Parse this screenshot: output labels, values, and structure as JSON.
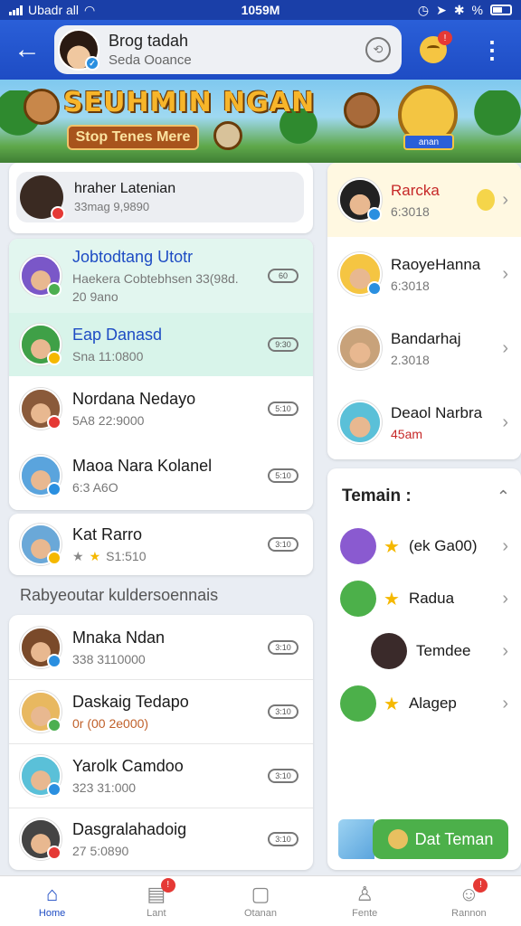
{
  "status_bar": {
    "carrier": "Ubadr all",
    "time": "1059M",
    "battery": "%"
  },
  "header": {
    "back_icon": "arrow-left-icon",
    "search": {
      "name": "Brog tadah",
      "subtitle": "Seda Ooance"
    },
    "notification_count": "!"
  },
  "banner": {
    "title": "SEUHMIN NGAN",
    "button": "Stop Tenes Mere",
    "tag": "anan"
  },
  "left_top": {
    "name": "hraher Latenian",
    "sub": "33mag 9,9890"
  },
  "chats": [
    {
      "name": "Jobtodtang Utotr",
      "sub": "Haekera Cobtebhsen 33(98d.",
      "sub2": "20 9ano",
      "pill": "60",
      "highlight": "#e2f6ef",
      "avatar": "#7a57c8",
      "dot": "#4caf50",
      "name_color": "#1e4cc4"
    },
    {
      "name": "Eap Danasd",
      "sub": "Sna  11:0800",
      "pill": "9:30",
      "highlight": "#d8f4ea",
      "avatar": "#3fa047",
      "dot": "#f5b800",
      "name_color": "#1e4cc4"
    },
    {
      "name": "Nordana Nedayo",
      "sub": "5A8  22:9000",
      "pill": "5:10",
      "highlight": "#ffffff",
      "avatar": "#8a5a3a",
      "dot": "#e53935",
      "name_color": "#1a1a1a"
    },
    {
      "name": "Maoa Nara Kolanel",
      "sub": "6:3  A6O",
      "pill": "5:10",
      "highlight": "#ffffff",
      "avatar": "#5aa4dd",
      "dot": "#2a8fe0",
      "name_color": "#1a1a1a"
    },
    {
      "name": "Kat Rarro",
      "sub": "S1:510",
      "pill": "3:10",
      "highlight": "#ffffff",
      "avatar": "#6aa8d8",
      "dot": "#f5b800",
      "name_color": "#1a1a1a"
    }
  ],
  "section_label": "Rabyeoutar kuldersoennais",
  "chats2": [
    {
      "name": "Mnaka Ndan",
      "sub": "338  3110000",
      "pill": "3:10",
      "avatar": "#7a4a2a",
      "dot": "#2a8fe0"
    },
    {
      "name": "Daskaig Tedapo",
      "sub": "0r  (00 2e000)",
      "pill": "3:10",
      "avatar": "#e8b860",
      "dot": "#4caf50"
    },
    {
      "name": "Yarolk Camdoo",
      "sub": "323  31:000",
      "pill": "3:10",
      "avatar": "#5ac0d8",
      "dot": "#2a8fe0"
    },
    {
      "name": "Dasgralahadoig",
      "sub": "27  5:0890",
      "pill": "3:10",
      "avatar": "#444444",
      "dot": "#e53935"
    }
  ],
  "right_top": [
    {
      "name": "Rarcka",
      "sub": "6:3018",
      "avatar": "#222222",
      "name_color": "#c62828",
      "bg": "#fff8e1",
      "dot": "#2a8fe0"
    },
    {
      "name": "RaoyeHanna",
      "sub": "6:3018",
      "avatar": "#f5c542",
      "name_color": "#1a1a1a",
      "bg": "#ffffff",
      "dot": "#2a8fe0"
    },
    {
      "name": "Bandarhaj",
      "sub": "2.3018",
      "avatar": "#c8a27a",
      "name_color": "#1a1a1a",
      "bg": "#ffffff",
      "dot": ""
    },
    {
      "name": "Deaol Narbra",
      "sub": "45am",
      "avatar": "#5ac0d8",
      "name_color": "#1a1a1a",
      "bg": "#ffffff",
      "dot": ""
    }
  ],
  "teman": {
    "title": "Temain :",
    "items": [
      {
        "name": "(ek Ga00)",
        "avatar": "#8a5ad0"
      },
      {
        "name": "Radua",
        "avatar": "#4cb04a"
      },
      {
        "name": "Temdee",
        "avatar": "#3a2a2a"
      },
      {
        "name": "Alagep",
        "avatar": "#4cb04a"
      }
    ]
  },
  "add_button": "Dat Teman",
  "nav": [
    {
      "label": "Home",
      "icon": "home-icon",
      "badge": ""
    },
    {
      "label": "Lant",
      "icon": "chat-icon",
      "badge": "!"
    },
    {
      "label": "Otanan",
      "icon": "square-icon",
      "badge": ""
    },
    {
      "label": "Fente",
      "icon": "person-icon",
      "badge": ""
    },
    {
      "label": "Rannon",
      "icon": "profile-icon",
      "badge": "!"
    }
  ]
}
